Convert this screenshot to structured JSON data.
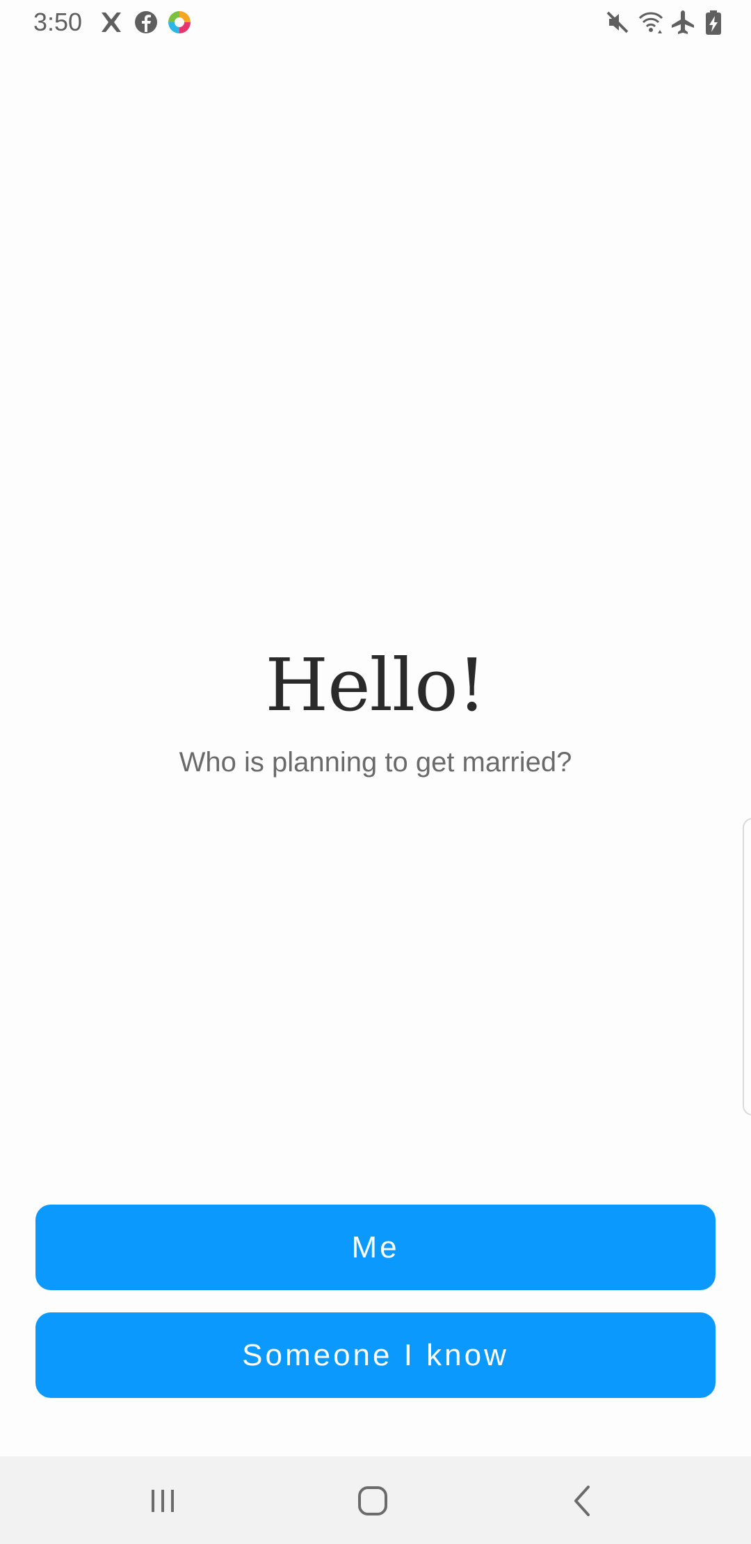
{
  "status_bar": {
    "time": "3:50",
    "left_icons": [
      "x-app-icon",
      "facebook-icon",
      "colorful-app-icon"
    ],
    "right_icons": [
      "mute-icon",
      "wifi-icon",
      "airplane-mode-icon",
      "battery-charging-icon"
    ]
  },
  "main": {
    "title": "Hello!",
    "subtitle": "Who is planning to get married?"
  },
  "buttons": {
    "me_label": "Me",
    "someone_label": "Someone I know"
  },
  "colors": {
    "accent": "#0b99fe",
    "background": "#fdfdfd",
    "title_text": "#2a2a2a",
    "subtitle_text": "#6a6a6a",
    "nav_bar": "#f2f2f2"
  },
  "nav_bar": {
    "icons": [
      "recents-icon",
      "home-icon",
      "back-icon"
    ]
  }
}
